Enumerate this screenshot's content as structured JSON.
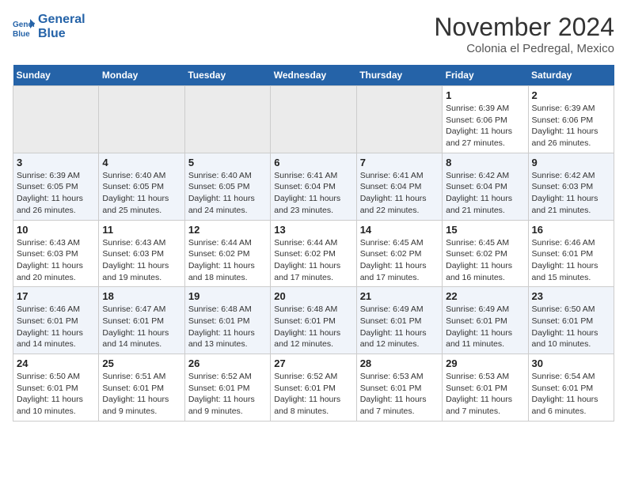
{
  "header": {
    "logo_line1": "General",
    "logo_line2": "Blue",
    "month": "November 2024",
    "location": "Colonia el Pedregal, Mexico"
  },
  "days_of_week": [
    "Sunday",
    "Monday",
    "Tuesday",
    "Wednesday",
    "Thursday",
    "Friday",
    "Saturday"
  ],
  "weeks": [
    [
      {
        "num": "",
        "info": "",
        "empty": true
      },
      {
        "num": "",
        "info": "",
        "empty": true
      },
      {
        "num": "",
        "info": "",
        "empty": true
      },
      {
        "num": "",
        "info": "",
        "empty": true
      },
      {
        "num": "",
        "info": "",
        "empty": true
      },
      {
        "num": "1",
        "info": "Sunrise: 6:39 AM\nSunset: 6:06 PM\nDaylight: 11 hours\nand 27 minutes.",
        "empty": false
      },
      {
        "num": "2",
        "info": "Sunrise: 6:39 AM\nSunset: 6:06 PM\nDaylight: 11 hours\nand 26 minutes.",
        "empty": false
      }
    ],
    [
      {
        "num": "3",
        "info": "Sunrise: 6:39 AM\nSunset: 6:05 PM\nDaylight: 11 hours\nand 26 minutes.",
        "empty": false
      },
      {
        "num": "4",
        "info": "Sunrise: 6:40 AM\nSunset: 6:05 PM\nDaylight: 11 hours\nand 25 minutes.",
        "empty": false
      },
      {
        "num": "5",
        "info": "Sunrise: 6:40 AM\nSunset: 6:05 PM\nDaylight: 11 hours\nand 24 minutes.",
        "empty": false
      },
      {
        "num": "6",
        "info": "Sunrise: 6:41 AM\nSunset: 6:04 PM\nDaylight: 11 hours\nand 23 minutes.",
        "empty": false
      },
      {
        "num": "7",
        "info": "Sunrise: 6:41 AM\nSunset: 6:04 PM\nDaylight: 11 hours\nand 22 minutes.",
        "empty": false
      },
      {
        "num": "8",
        "info": "Sunrise: 6:42 AM\nSunset: 6:04 PM\nDaylight: 11 hours\nand 21 minutes.",
        "empty": false
      },
      {
        "num": "9",
        "info": "Sunrise: 6:42 AM\nSunset: 6:03 PM\nDaylight: 11 hours\nand 21 minutes.",
        "empty": false
      }
    ],
    [
      {
        "num": "10",
        "info": "Sunrise: 6:43 AM\nSunset: 6:03 PM\nDaylight: 11 hours\nand 20 minutes.",
        "empty": false
      },
      {
        "num": "11",
        "info": "Sunrise: 6:43 AM\nSunset: 6:03 PM\nDaylight: 11 hours\nand 19 minutes.",
        "empty": false
      },
      {
        "num": "12",
        "info": "Sunrise: 6:44 AM\nSunset: 6:02 PM\nDaylight: 11 hours\nand 18 minutes.",
        "empty": false
      },
      {
        "num": "13",
        "info": "Sunrise: 6:44 AM\nSunset: 6:02 PM\nDaylight: 11 hours\nand 17 minutes.",
        "empty": false
      },
      {
        "num": "14",
        "info": "Sunrise: 6:45 AM\nSunset: 6:02 PM\nDaylight: 11 hours\nand 17 minutes.",
        "empty": false
      },
      {
        "num": "15",
        "info": "Sunrise: 6:45 AM\nSunset: 6:02 PM\nDaylight: 11 hours\nand 16 minutes.",
        "empty": false
      },
      {
        "num": "16",
        "info": "Sunrise: 6:46 AM\nSunset: 6:01 PM\nDaylight: 11 hours\nand 15 minutes.",
        "empty": false
      }
    ],
    [
      {
        "num": "17",
        "info": "Sunrise: 6:46 AM\nSunset: 6:01 PM\nDaylight: 11 hours\nand 14 minutes.",
        "empty": false
      },
      {
        "num": "18",
        "info": "Sunrise: 6:47 AM\nSunset: 6:01 PM\nDaylight: 11 hours\nand 14 minutes.",
        "empty": false
      },
      {
        "num": "19",
        "info": "Sunrise: 6:48 AM\nSunset: 6:01 PM\nDaylight: 11 hours\nand 13 minutes.",
        "empty": false
      },
      {
        "num": "20",
        "info": "Sunrise: 6:48 AM\nSunset: 6:01 PM\nDaylight: 11 hours\nand 12 minutes.",
        "empty": false
      },
      {
        "num": "21",
        "info": "Sunrise: 6:49 AM\nSunset: 6:01 PM\nDaylight: 11 hours\nand 12 minutes.",
        "empty": false
      },
      {
        "num": "22",
        "info": "Sunrise: 6:49 AM\nSunset: 6:01 PM\nDaylight: 11 hours\nand 11 minutes.",
        "empty": false
      },
      {
        "num": "23",
        "info": "Sunrise: 6:50 AM\nSunset: 6:01 PM\nDaylight: 11 hours\nand 10 minutes.",
        "empty": false
      }
    ],
    [
      {
        "num": "24",
        "info": "Sunrise: 6:50 AM\nSunset: 6:01 PM\nDaylight: 11 hours\nand 10 minutes.",
        "empty": false
      },
      {
        "num": "25",
        "info": "Sunrise: 6:51 AM\nSunset: 6:01 PM\nDaylight: 11 hours\nand 9 minutes.",
        "empty": false
      },
      {
        "num": "26",
        "info": "Sunrise: 6:52 AM\nSunset: 6:01 PM\nDaylight: 11 hours\nand 9 minutes.",
        "empty": false
      },
      {
        "num": "27",
        "info": "Sunrise: 6:52 AM\nSunset: 6:01 PM\nDaylight: 11 hours\nand 8 minutes.",
        "empty": false
      },
      {
        "num": "28",
        "info": "Sunrise: 6:53 AM\nSunset: 6:01 PM\nDaylight: 11 hours\nand 7 minutes.",
        "empty": false
      },
      {
        "num": "29",
        "info": "Sunrise: 6:53 AM\nSunset: 6:01 PM\nDaylight: 11 hours\nand 7 minutes.",
        "empty": false
      },
      {
        "num": "30",
        "info": "Sunrise: 6:54 AM\nSunset: 6:01 PM\nDaylight: 11 hours\nand 6 minutes.",
        "empty": false
      }
    ]
  ]
}
